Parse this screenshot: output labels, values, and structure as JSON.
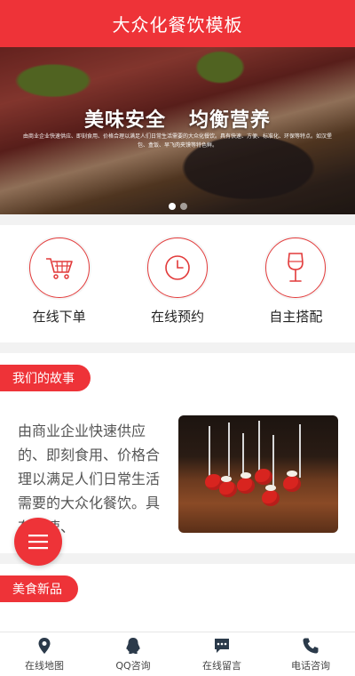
{
  "header": {
    "title": "大众化餐饮模板"
  },
  "banner": {
    "title_left": "美味安全",
    "title_right": "均衡营养",
    "subtitle": "由商业企业快速供应、即刻食用、价格合理以满足人们日常生活需要的大众化餐饮。具有快速、方便、标准化、环保等特点。如汉堡包、盒饭、早飞肉夹馍等特色鲜。",
    "slide_count": 2,
    "active_slide": 1
  },
  "features": [
    {
      "label": "在线下单",
      "icon": "shopping-cart-icon"
    },
    {
      "label": "在线预约",
      "icon": "clock-icon"
    },
    {
      "label": "自主搭配",
      "icon": "wine-glass-icon"
    }
  ],
  "story": {
    "tab_label": "我们的故事",
    "text": "由商业企业快速供应的、即刻食用、价格合理以满足人们日常生活需要的大众化餐饮。具有快速、",
    "image": "cherry-tomato-skewers-photo"
  },
  "new_food": {
    "tab_label": "美食新品"
  },
  "fab": {
    "icon": "menu-icon"
  },
  "bottom_nav": [
    {
      "label": "在线地图",
      "icon": "map-pin-icon"
    },
    {
      "label": "QQ咨询",
      "icon": "qq-icon"
    },
    {
      "label": "在线留言",
      "icon": "message-icon"
    },
    {
      "label": "电话咨询",
      "icon": "phone-icon"
    }
  ],
  "colors": {
    "accent": "#ee3338",
    "icon_dark": "#2b3a4a"
  }
}
